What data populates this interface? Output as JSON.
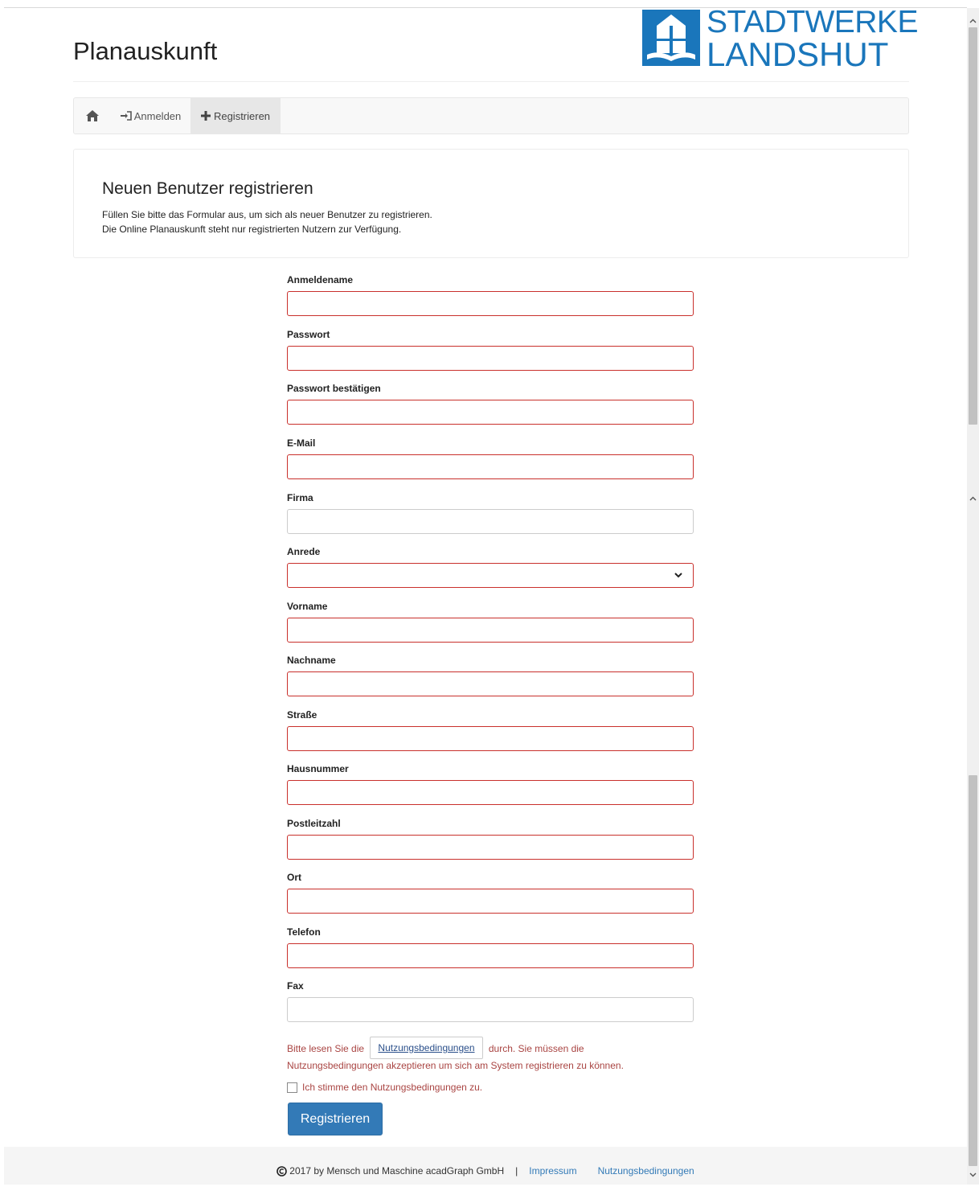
{
  "header": {
    "title": "Planauskunft",
    "logo_line1": "STADTWERKE",
    "logo_line2": "LANDSHUT",
    "brand_color": "#1a76bb"
  },
  "nav": {
    "home_icon": "home-icon",
    "login_label": "Anmelden",
    "register_label": "Registrieren"
  },
  "intro": {
    "heading": "Neuen Benutzer registrieren",
    "line1": "Füllen Sie bitte das Formular aus, um sich als neuer Benutzer zu registrieren.",
    "line2": "Die Online Planauskunft steht nur registrierten Nutzern zur Verfügung."
  },
  "form": {
    "fields": [
      {
        "label": "Anmeldename",
        "value": ""
      },
      {
        "label": "Passwort",
        "value": ""
      },
      {
        "label": "Passwort bestätigen",
        "value": ""
      },
      {
        "label": "E-Mail",
        "value": ""
      },
      {
        "label": "Firma",
        "value": ""
      },
      {
        "label": "Anrede",
        "value": ""
      },
      {
        "label": "Vorname",
        "value": ""
      },
      {
        "label": "Nachname",
        "value": ""
      },
      {
        "label": "Straße",
        "value": ""
      },
      {
        "label": "Hausnummer",
        "value": ""
      },
      {
        "label": "Postleitzahl",
        "value": ""
      },
      {
        "label": "Ort",
        "value": ""
      },
      {
        "label": "Telefon",
        "value": ""
      },
      {
        "label": "Fax",
        "value": ""
      }
    ],
    "error_color": "#c9302c"
  },
  "terms": {
    "prefix": "Bitte lesen Sie die",
    "link_label": "Nutzungsbedingungen",
    "suffix": "durch. Sie müssen die",
    "line2": "Nutzungsbedingungen akzeptieren um sich am System registrieren zu können.",
    "agree_label": "Ich stimme den Nutzungsbedingungen zu.",
    "agree_checked": false
  },
  "submit_label": "Registrieren",
  "footer": {
    "copyright": "2017 by Mensch und Maschine acadGraph GmbH",
    "separator": "|",
    "impressum": "Impressum",
    "terms": "Nutzungsbedingungen"
  }
}
